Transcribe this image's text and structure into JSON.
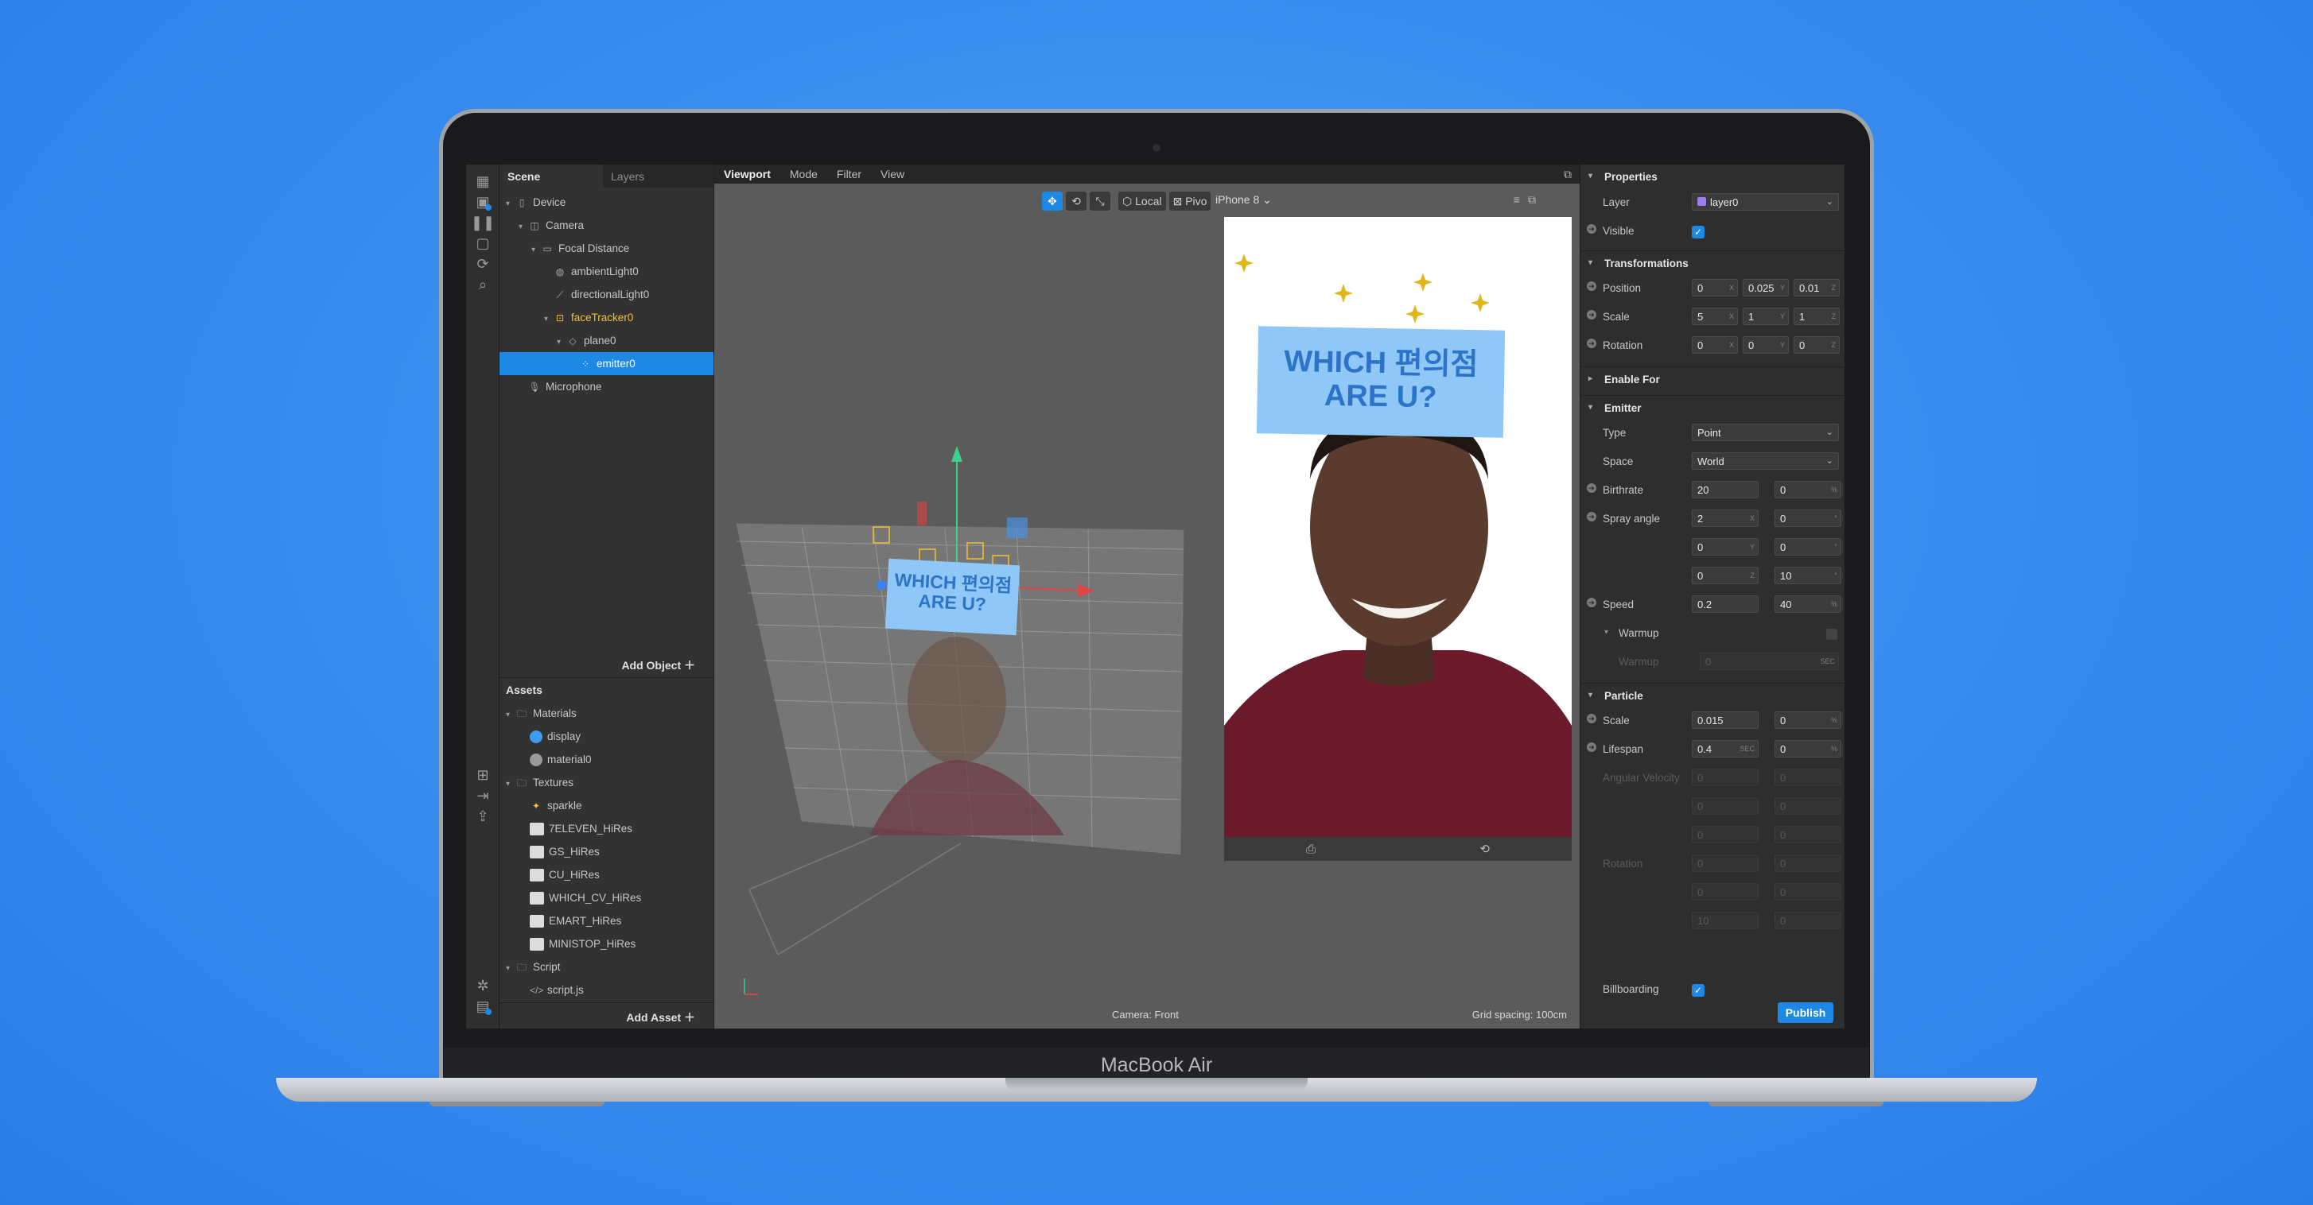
{
  "device_label": "MacBook Air",
  "scene_tabs": [
    "Scene",
    "Layers"
  ],
  "scene_tree": [
    {
      "label": "Device",
      "icon": "phone-icon",
      "depth": 0,
      "caret": "▾"
    },
    {
      "label": "Camera",
      "icon": "camera-icon",
      "depth": 1,
      "caret": "▾"
    },
    {
      "label": "Focal Distance",
      "icon": "focal-distance-icon",
      "depth": 2,
      "caret": "▾"
    },
    {
      "label": "ambientLight0",
      "icon": "ambient-light-icon",
      "depth": 3,
      "caret": ""
    },
    {
      "label": "directionalLight0",
      "icon": "directional-light-icon",
      "depth": 3,
      "caret": ""
    },
    {
      "label": "faceTracker0",
      "icon": "face-tracker-icon",
      "depth": 3,
      "caret": "▾"
    },
    {
      "label": "plane0",
      "icon": "plane-icon",
      "depth": 4,
      "caret": "▾"
    },
    {
      "label": "emitter0",
      "icon": "emitter-icon",
      "depth": 5,
      "caret": ""
    },
    {
      "label": "Microphone",
      "icon": "microphone-icon",
      "depth": 1,
      "caret": ""
    }
  ],
  "add_object": "Add Object",
  "assets_title": "Assets",
  "assets_tree": [
    {
      "label": "Materials",
      "depth": 0,
      "type": "folder"
    },
    {
      "label": "display",
      "depth": 1,
      "type": "material-blue"
    },
    {
      "label": "material0",
      "depth": 1,
      "type": "material-grey"
    },
    {
      "label": "Textures",
      "depth": 0,
      "type": "folder"
    },
    {
      "label": "sparkle",
      "depth": 1,
      "type": "sparkle"
    },
    {
      "label": "7ELEVEN_HiRes",
      "depth": 1,
      "type": "texture"
    },
    {
      "label": "GS_HiRes",
      "depth": 1,
      "type": "texture"
    },
    {
      "label": "CU_HiRes",
      "depth": 1,
      "type": "texture"
    },
    {
      "label": "WHICH_CV_HiRes",
      "depth": 1,
      "type": "texture"
    },
    {
      "label": "EMART_HiRes",
      "depth": 1,
      "type": "texture"
    },
    {
      "label": "MINISTOP_HiRes",
      "depth": 1,
      "type": "texture"
    },
    {
      "label": "Script",
      "depth": 0,
      "type": "folder"
    },
    {
      "label": "script.js",
      "depth": 1,
      "type": "script"
    }
  ],
  "add_asset": "Add Asset",
  "viewport_tabs": [
    "Viewport",
    "Mode",
    "Filter",
    "View"
  ],
  "viewport_tools": {
    "local": "Local",
    "pivot": "Pivo"
  },
  "device_select": "iPhone 8",
  "sign_text": {
    "line1": "WHICH 편의점",
    "line2": "ARE U?"
  },
  "camera_status": "Camera: Front",
  "grid_status": "Grid spacing: 100cm",
  "properties": {
    "title": "Properties",
    "layer_label": "Layer",
    "layer_value": "layer0",
    "visible_label": "Visible",
    "transformations": "Transformations",
    "position_label": "Position",
    "position": [
      "0",
      "0.025",
      "0.01"
    ],
    "scale_label": "Scale",
    "scale": [
      "5",
      "1",
      "1"
    ],
    "rotation_label": "Rotation",
    "rotation": [
      "0",
      "0",
      "0"
    ],
    "enable_for": "Enable For",
    "emitter": "Emitter",
    "type_label": "Type",
    "type_value": "Point",
    "space_label": "Space",
    "space_value": "World",
    "birthrate_label": "Birthrate",
    "birthrate": [
      "20",
      "0"
    ],
    "spray_label": "Spray angle",
    "spray": [
      "2",
      "0",
      "0",
      "0",
      "0",
      "10"
    ],
    "speed_label": "Speed",
    "speed": [
      "0.2",
      "40"
    ],
    "warmup_head": "Warmup",
    "warmup_label": "Warmup",
    "warmup_value": "0",
    "particle": "Particle",
    "pscale_label": "Scale",
    "pscale": [
      "0.015",
      "0"
    ],
    "lifespan_label": "Lifespan",
    "lifespan": [
      "0.4",
      "0"
    ],
    "angular_label": "Angular Velocity",
    "rotation2_label": "Rotation",
    "dim_values": [
      "0",
      "0",
      "0",
      "0",
      "0",
      "0",
      "0",
      "0",
      "0",
      "0",
      "10",
      "0"
    ],
    "billboarding_label": "Billboarding",
    "publish": "Publish"
  },
  "colors": {
    "accent": "#1e88e5",
    "sign": "#8fc7f6",
    "sign_text": "#2d74c9"
  }
}
